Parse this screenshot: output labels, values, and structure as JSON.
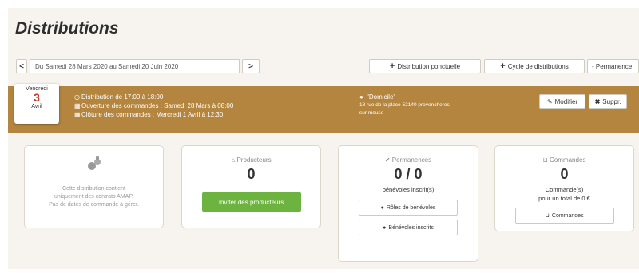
{
  "page": {
    "title": "Distributions"
  },
  "toolbar": {
    "prev_label": "<",
    "date_range": "Du Samedi 28 Mars 2020 au Samedi 20 Juin 2020",
    "next_label": ">",
    "one_off_label": "Distribution ponctuelle",
    "cycle_label": "Cycle de distributions",
    "duty_label": "- Permanence"
  },
  "distribution": {
    "date": {
      "weekday": "Vendredi",
      "day": "3",
      "month": "Avril"
    },
    "time_line": "Distribution de 17:00 à 18:00",
    "opening_line": "Ouverture des commandes : Samedi 28 Mars à 08:00",
    "closing_line": "Clôture des commandes : Mercredi 1 Avril à 12:30",
    "place_name": "\"Domicile\"",
    "address_line1": "18 rue de la place 52140 provencheres",
    "address_line2": "sur meuse",
    "edit_label": "Modifier",
    "delete_label": "Suppr."
  },
  "cards": {
    "contracts": {
      "line1": "Cette distribution contient",
      "line2": "uniquement des contrats AMAP.",
      "line3": "Pas de dates de commande à gérer."
    },
    "producers": {
      "title": "Producteurs",
      "count": "0",
      "invite_label": "Inviter des producteurs"
    },
    "duties": {
      "title": "Permanences",
      "count": "0 / 0",
      "subtitle": "bénévoles inscrit(s)",
      "roles_label": "Rôles de bénévoles",
      "registered_label": "Bénévoles inscrits"
    },
    "orders": {
      "title": "Commandes",
      "count": "0",
      "subtitle1": "Commande(s)",
      "subtitle2": "pour un total de 0 €",
      "orders_label": "Commandes"
    }
  },
  "colors": {
    "band": "#b3853f",
    "accent_red": "#c0392b",
    "green": "#6db33f",
    "panel": "#f7f4ef"
  }
}
